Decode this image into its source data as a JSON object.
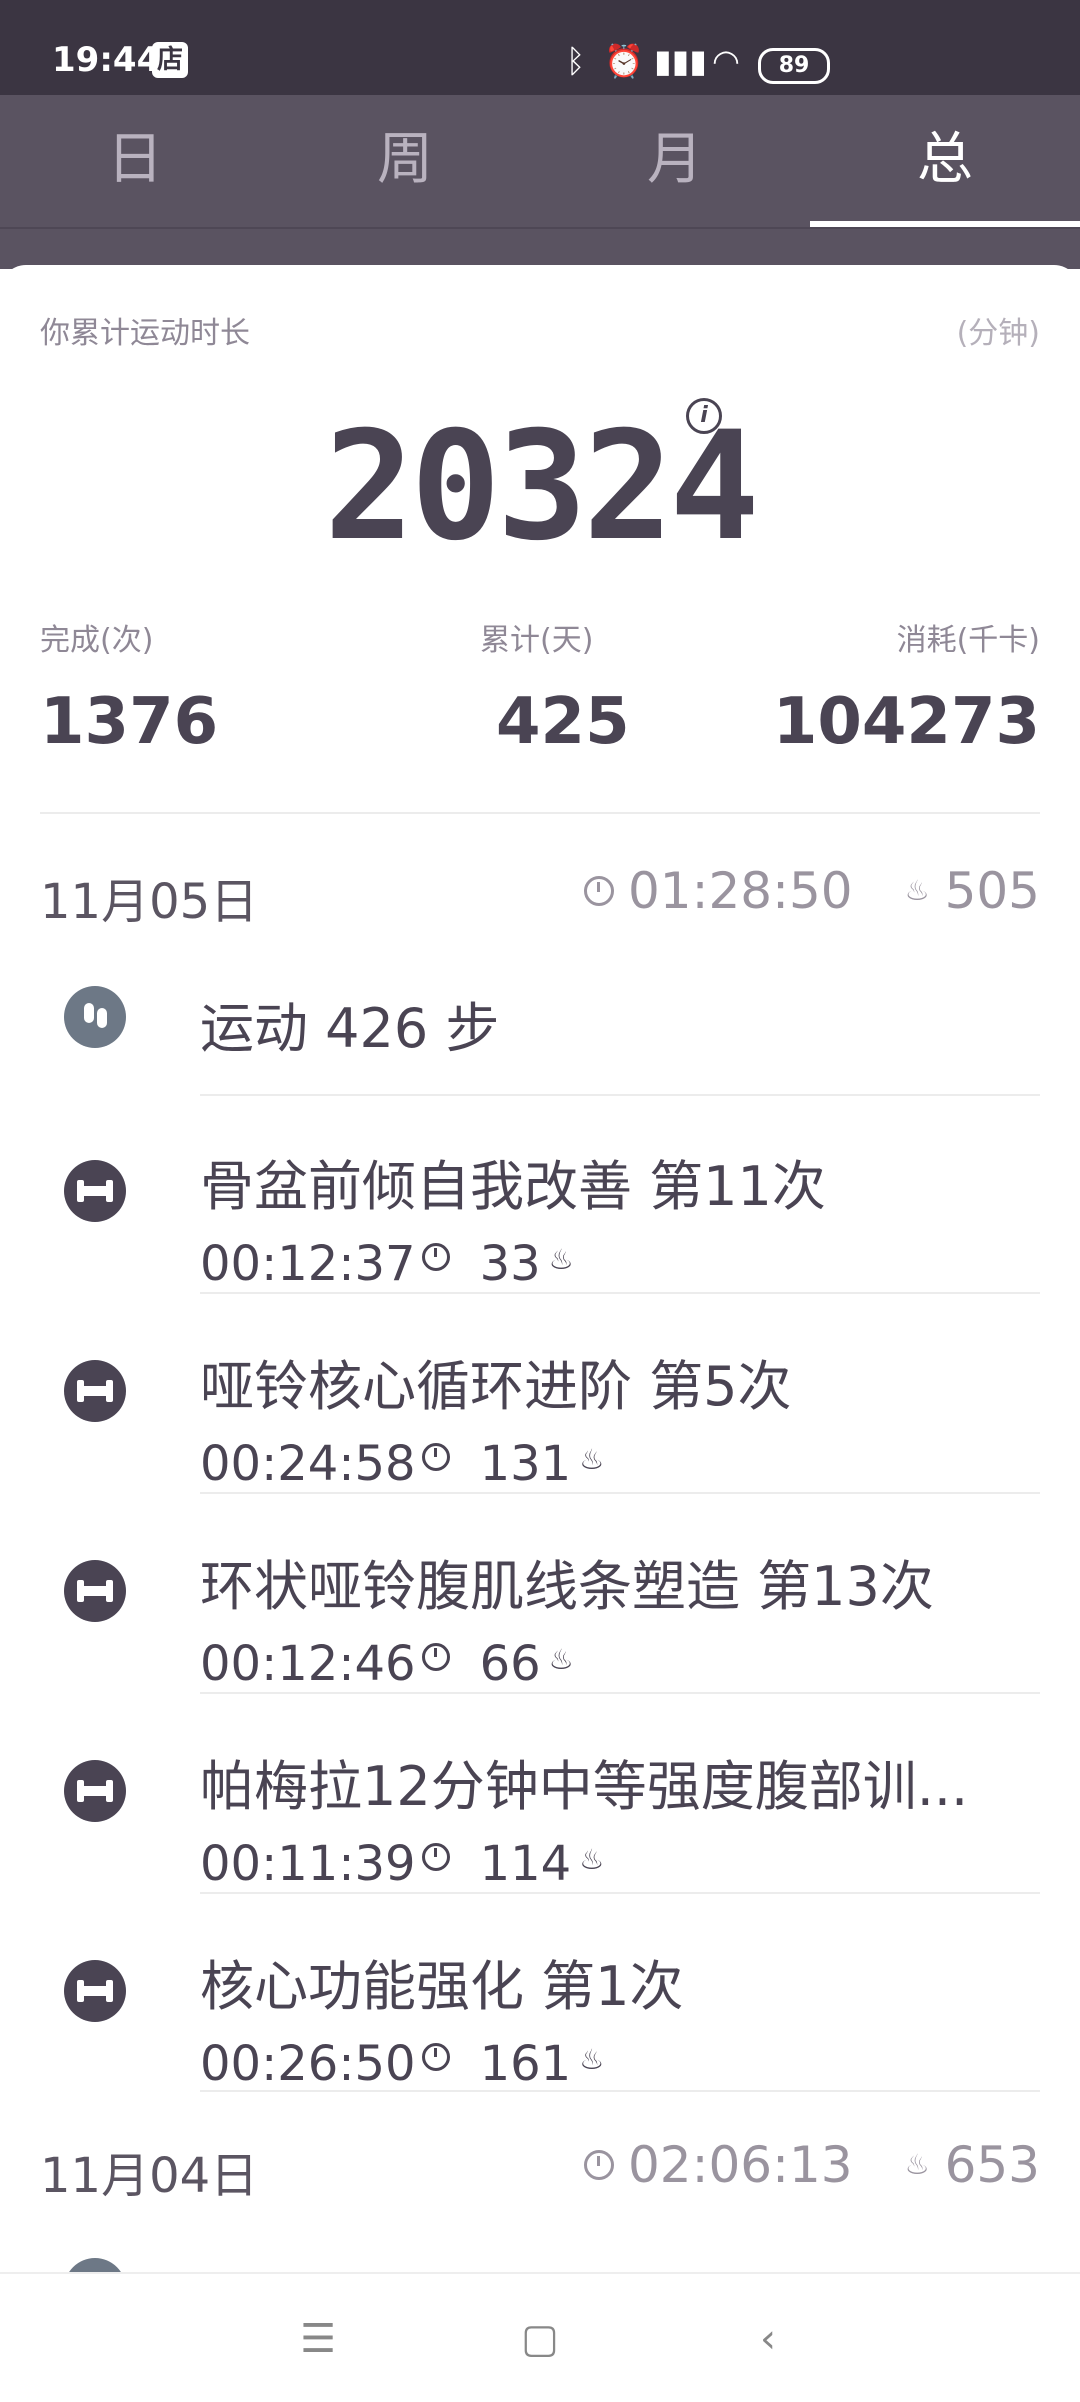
{
  "status_bar": {
    "time": "19:44",
    "store_label": "店",
    "battery": "89"
  },
  "tabs": [
    {
      "label": "日",
      "active": false
    },
    {
      "label": "周",
      "active": false
    },
    {
      "label": "月",
      "active": false
    },
    {
      "label": "总",
      "active": true
    }
  ],
  "summary": {
    "label": "你累计运动时长",
    "unit": "(分钟)",
    "total_minutes": "20324",
    "stats": [
      {
        "label": "完成(次)",
        "value": "1376"
      },
      {
        "label": "累计(天)",
        "value": "425"
      },
      {
        "label": "消耗(千卡)",
        "value": "104273"
      }
    ]
  },
  "days": [
    {
      "date": "11月05日",
      "duration": "01:28:50",
      "calories": "505",
      "steps_text": "运动 426 步",
      "workouts": [
        {
          "title": "骨盆前倾自我改善 第11次",
          "duration": "00:12:37",
          "calories": "33"
        },
        {
          "title": "哑铃核心循环进阶 第5次",
          "duration": "00:24:58",
          "calories": "131"
        },
        {
          "title": "环状哑铃腹肌线条塑造 第13次",
          "duration": "00:12:46",
          "calories": "66"
        },
        {
          "title": "帕梅拉12分钟中等强度腹部训...",
          "duration": "00:11:39",
          "calories": "114"
        },
        {
          "title": "核心功能强化 第1次",
          "duration": "00:26:50",
          "calories": "161"
        }
      ]
    },
    {
      "date": "11月04日",
      "duration": "02:06:13",
      "calories": "653"
    }
  ],
  "icons": {
    "bluetooth": "bluetooth-icon",
    "alarm": "alarm-icon",
    "signal": "signal-icon",
    "wifi": "wifi-icon",
    "info": "info-icon",
    "clock": "clock-icon",
    "flame": "flame-icon",
    "dumbbell": "dumbbell-icon",
    "footprints": "footprints-icon",
    "menu": "menu-icon",
    "home": "home-icon",
    "back": "back-icon"
  },
  "colors": {
    "header_bg": "#5a5361",
    "status_bg": "#3b3542",
    "text_dark": "#4a4453",
    "text_muted": "#9a949f"
  }
}
